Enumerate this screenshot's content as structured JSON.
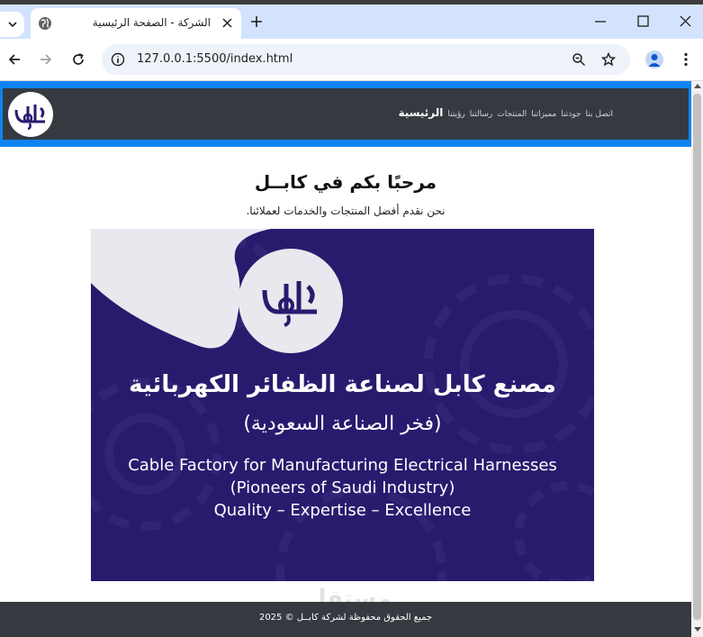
{
  "browser": {
    "tab_title": "الشركة - الصفحة الرئيسية",
    "url": "127.0.0.1:5500/index.html"
  },
  "icons": {
    "tab_search": "chevron-down-icon",
    "tab_favicon": "globe-icon",
    "tab_close": "close-icon",
    "new_tab": "plus-icon",
    "back": "back-arrow-icon",
    "forward": "forward-arrow-icon",
    "reload": "reload-icon",
    "site_info": "info-icon",
    "zoom": "zoom-icon",
    "bookmark": "star-icon",
    "profile": "profile-icon",
    "menu": "kebab-menu-icon"
  },
  "site": {
    "nav": {
      "home": "الرئيسية",
      "links": [
        "رؤيتنا",
        "رسالتنا",
        "المنتجات",
        "مميزاتنا",
        "جودتنا",
        "اتصل بنا"
      ]
    },
    "title": "مرحبًا بكم في كابــل",
    "subtitle": "نحن نقدم أفضل المنتجات والخدمات لعملائنا.",
    "hero": {
      "title_ar": "مصنع كابل لصناعة الظفائر الكهربائية",
      "subtitle_ar": "(فخر الصناعة السعودية)",
      "lines_en": [
        "Cable Factory for Manufacturing Electrical Harnesses",
        "(Pioneers of Saudi Industry)",
        "Quality – Expertise – Excellence"
      ]
    },
    "footer": "جميع الحقوق محفوظة لشركة كابــل © 2025",
    "watermark": "مستقل"
  },
  "colors": {
    "header_border": "#0d84f0",
    "header_bg": "#343a40",
    "hero_bg": "#2a1a6e",
    "footer_bg": "#343a40"
  }
}
